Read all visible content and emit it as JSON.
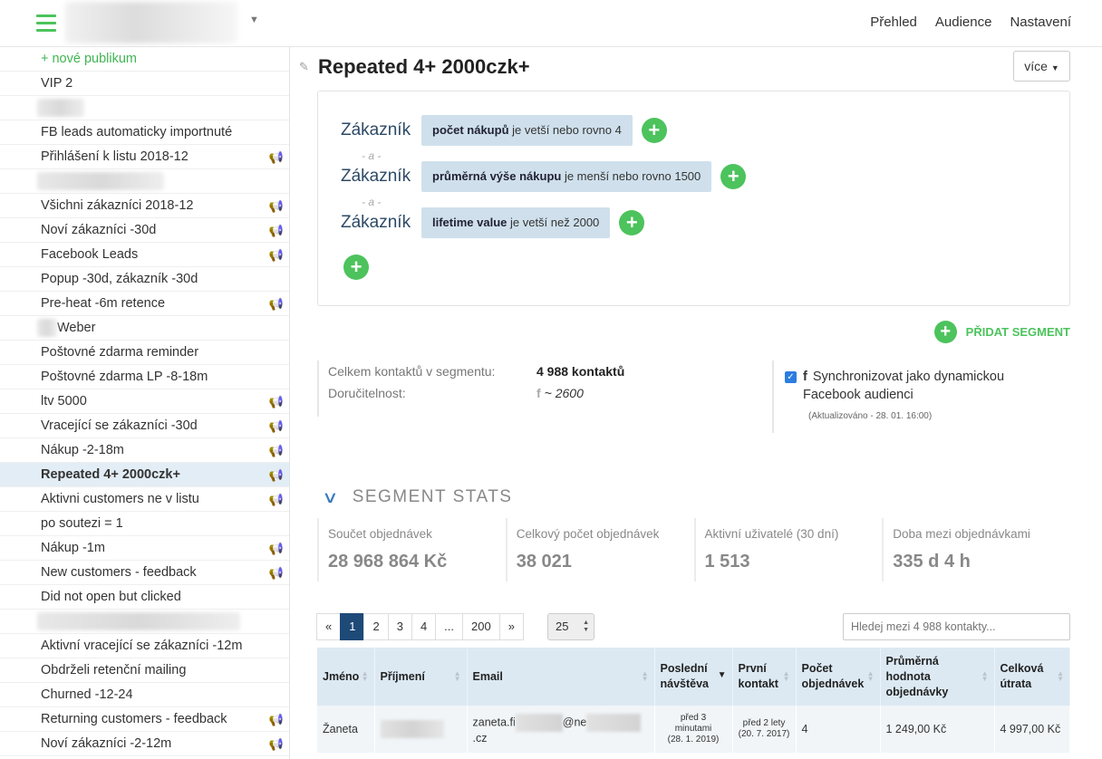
{
  "topnav": [
    "Přehled",
    "Audience",
    "Nastavení"
  ],
  "sidebar": {
    "add_label": "+ nové publikum",
    "items": [
      {
        "label": "VIP 2",
        "fb": false
      },
      {
        "label": "",
        "fb": false,
        "blur": 52
      },
      {
        "label": "FB leads automaticky importnuté",
        "fb": false
      },
      {
        "label": "Přihlášení k listu 2018-12",
        "fb": true
      },
      {
        "label": "",
        "fb": false,
        "blur": 140
      },
      {
        "label": "Všichni zákazníci 2018-12",
        "fb": true
      },
      {
        "label": "Noví zákazníci -30d",
        "fb": true
      },
      {
        "label": "Facebook Leads",
        "fb": true
      },
      {
        "label": "Popup -30d, zákazník -30d",
        "fb": false
      },
      {
        "label": "Pre-heat -6m retence",
        "fb": true
      },
      {
        "label": "Weber",
        "fb": false,
        "prefix_blur": 22
      },
      {
        "label": "Poštovné zdarma reminder",
        "fb": false
      },
      {
        "label": "Poštovné zdarma LP -8-18m",
        "fb": false
      },
      {
        "label": "ltv 5000",
        "fb": true
      },
      {
        "label": "Vracející se zákazníci -30d",
        "fb": true
      },
      {
        "label": "Nákup -2-18m",
        "fb": true
      },
      {
        "label": "Repeated 4+ 2000czk+",
        "fb": true,
        "active": true
      },
      {
        "label": "Aktivni customers ne v listu",
        "fb": true
      },
      {
        "label": "po soutezi = 1",
        "fb": false
      },
      {
        "label": "Nákup -1m",
        "fb": true
      },
      {
        "label": "New customers - feedback",
        "fb": true
      },
      {
        "label": "Did not open but clicked",
        "fb": false
      },
      {
        "label": "",
        "fb": false,
        "blur": 224
      },
      {
        "label": "Aktivní vracející se zákazníci -12m",
        "fb": false
      },
      {
        "label": "Obdrželi retenční mailing",
        "fb": false
      },
      {
        "label": "Churned -12-24",
        "fb": false
      },
      {
        "label": "Returning customers - feedback",
        "fb": true
      },
      {
        "label": "Noví zákazníci -2-12m",
        "fb": true
      }
    ]
  },
  "main": {
    "title": "Repeated 4+ 2000czk+",
    "more_button": "více",
    "conditions": [
      {
        "entity": "Zákazník",
        "field": "počet nákupů",
        "rest": " je vetší nebo rovno 4"
      },
      {
        "entity": "Zákazník",
        "field": "průměrná výše nákupu",
        "rest": " je menší nebo rovno 1500"
      },
      {
        "entity": "Zákazník",
        "field": "lifetime value",
        "rest": " je vetší než 2000"
      }
    ],
    "and_label": "- a -",
    "add_segment": "PŘIDAT SEGMENT",
    "info": {
      "total_label": "Celkem kontaktů v segmentu:",
      "total_value": "4 988 kontaktů",
      "deliv_label": "Doručitelnost:",
      "deliv_value": "~ 2600",
      "sync_label": "Synchronizovat jako dynamickou Facebook audienci",
      "sync_checked": true,
      "updated": "(Aktualizováno - 28. 01. 16:00)"
    },
    "stats_title": "SEGMENT STATS",
    "stats": [
      {
        "label": "Součet objednávek",
        "value": "28 968 864 Kč"
      },
      {
        "label": "Celkový počet objednávek",
        "value": "38 021"
      },
      {
        "label": "Aktivní uživatelé (30 dní)",
        "value": "1 513"
      },
      {
        "label": "Doba mezi objednávkami",
        "value": "335 d 4 h"
      }
    ],
    "pager": [
      "«",
      "1",
      "2",
      "3",
      "4",
      "...",
      "200",
      "»"
    ],
    "per_page": "25",
    "search_placeholder": "Hledej mezi 4 988 kontakty...",
    "table": {
      "headers": [
        "Jméno",
        "Příjmení",
        "Email",
        "Poslední návštěva",
        "První kontakt",
        "Počet objednávek",
        "Průměrná hodnota objednávky",
        "Celková útrata"
      ],
      "rows": [
        {
          "jmeno": "Žaneta",
          "email_a": "zaneta.fi",
          "email_b": "@ne",
          "email_c": ".cz",
          "posledni_1": "před 3",
          "posledni_2": "minutami",
          "posledni_3": "(28. 1. 2019)",
          "prvni_1": "před 2 lety",
          "prvni_2": "(20. 7. 2017)",
          "pocet": "4",
          "prumer": "1 249,00 Kč",
          "celkem": "4 997,00 Kč"
        }
      ]
    }
  }
}
